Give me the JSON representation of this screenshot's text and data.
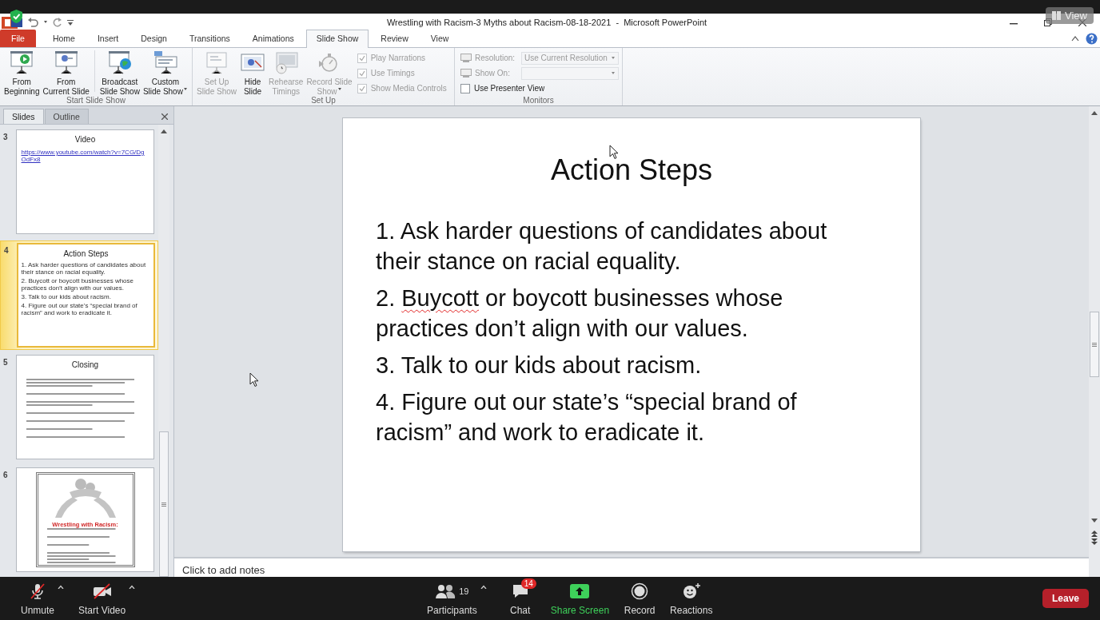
{
  "view_badge": {
    "label": "View"
  },
  "window": {
    "title": "Wrestling with Racism-3 Myths about Racism-08-18-2021  -  Microsoft PowerPoint"
  },
  "ribbon_tabs": [
    {
      "label": "File",
      "kind": "file",
      "selected": false
    },
    {
      "label": "Home",
      "kind": "tab",
      "selected": false
    },
    {
      "label": "Insert",
      "kind": "tab",
      "selected": false
    },
    {
      "label": "Design",
      "kind": "tab",
      "selected": false
    },
    {
      "label": "Transitions",
      "kind": "tab",
      "selected": false
    },
    {
      "label": "Animations",
      "kind": "tab",
      "selected": false
    },
    {
      "label": "Slide Show",
      "kind": "tab",
      "selected": true
    },
    {
      "label": "Review",
      "kind": "tab",
      "selected": false
    },
    {
      "label": "View",
      "kind": "tab",
      "selected": false
    }
  ],
  "ribbon_groups": [
    {
      "label": "Start Slide Show",
      "items": [
        {
          "kind": "button",
          "label": "From\nBeginning",
          "disabled": false,
          "dropdown": false
        },
        {
          "kind": "button",
          "label": "From\nCurrent Slide",
          "disabled": false,
          "dropdown": false
        },
        {
          "kind": "separator"
        },
        {
          "kind": "button",
          "label": "Broadcast\nSlide Show",
          "disabled": false,
          "dropdown": false
        },
        {
          "kind": "button",
          "label": "Custom\nSlide Show",
          "disabled": false,
          "dropdown": true
        }
      ]
    },
    {
      "label": "Set Up",
      "items": [
        {
          "kind": "button",
          "label": "Set Up\nSlide Show",
          "disabled": true,
          "dropdown": false
        },
        {
          "kind": "button",
          "label": "Hide\nSlide",
          "disabled": false,
          "dropdown": false
        },
        {
          "kind": "button",
          "label": "Rehearse\nTimings",
          "disabled": true,
          "dropdown": false
        },
        {
          "kind": "button",
          "label": "Record Slide\nShow",
          "disabled": true,
          "dropdown": true
        },
        {
          "kind": "checkbox",
          "label": "Play Narrations",
          "checked": true,
          "disabled": true
        },
        {
          "kind": "checkbox",
          "label": "Use Timings",
          "checked": true,
          "disabled": true
        },
        {
          "kind": "checkbox",
          "label": "Show Media Controls",
          "checked": true,
          "disabled": true
        }
      ]
    },
    {
      "label": "Monitors",
      "items": [
        {
          "kind": "dropdown",
          "label": "Resolution:",
          "value": "Use Current Resolution",
          "disabled": true
        },
        {
          "kind": "dropdown",
          "label": "Show On:",
          "disabled": true
        },
        {
          "kind": "checkbox",
          "label": "Use Presenter View",
          "checked": false,
          "disabled": false
        }
      ]
    }
  ],
  "slide_panel": {
    "tabs": [
      {
        "label": "Slides",
        "selected": true
      },
      {
        "label": "Outline",
        "selected": false
      }
    ],
    "slides": [
      {
        "number": "3",
        "kind": "link",
        "selected": false,
        "title": "Video",
        "link": "https://www.youtube.com/watch?v=7CG/DgOdFx8"
      },
      {
        "number": "4",
        "kind": "steps",
        "selected": true,
        "title": "Action Steps",
        "points": [
          "1. Ask harder questions of candidates about their stance on racial equality.",
          "2. Buycott or boycott businesses whose practices don’t align with our values.",
          "3. Talk to our kids about racism.",
          "4. Figure out our state’s “special brand of racism” and work to eradicate it."
        ]
      },
      {
        "number": "5",
        "kind": "blurred",
        "selected": false,
        "title": "Closing"
      },
      {
        "number": "6",
        "kind": "poster",
        "selected": false,
        "title": "Wrestling with Racism:"
      }
    ]
  },
  "slide": {
    "title": "Action Steps",
    "points": [
      {
        "segments": [
          {
            "text": "1. Ask harder questions of candidates about their stance on racial equality.",
            "misspelled": false
          }
        ]
      },
      {
        "segments": [
          {
            "text": "2. ",
            "misspelled": false
          },
          {
            "text": "Buycott",
            "misspelled": true
          },
          {
            "text": " or boycott businesses  whose practices don’t align with our values.",
            "misspelled": false
          }
        ]
      },
      {
        "segments": [
          {
            "text": "3. Talk to our kids about racism.",
            "misspelled": false
          }
        ]
      },
      {
        "segments": [
          {
            "text": "4. Figure out our state’s “special brand of racism” and work to eradicate it.",
            "misspelled": false
          }
        ]
      }
    ]
  },
  "notes": {
    "placeholder": "Click to add notes"
  },
  "meeting_toolbar": {
    "left_controls": [
      {
        "label": "Unmute",
        "kind": "mic",
        "muted": true,
        "menu": true
      },
      {
        "label": "Start Video",
        "kind": "video",
        "muted": true,
        "menu": true
      }
    ],
    "center_controls": [
      {
        "label": "Participants",
        "kind": "participants",
        "count": "19",
        "menu": true
      },
      {
        "label": "Chat",
        "kind": "chat",
        "badge": "14",
        "menu": false
      },
      {
        "label": "Share Screen",
        "kind": "share",
        "menu": false
      },
      {
        "label": "Record",
        "kind": "record",
        "menu": false
      },
      {
        "label": "Reactions",
        "kind": "reactions",
        "menu": false
      }
    ],
    "leave": {
      "label": "Leave"
    }
  }
}
